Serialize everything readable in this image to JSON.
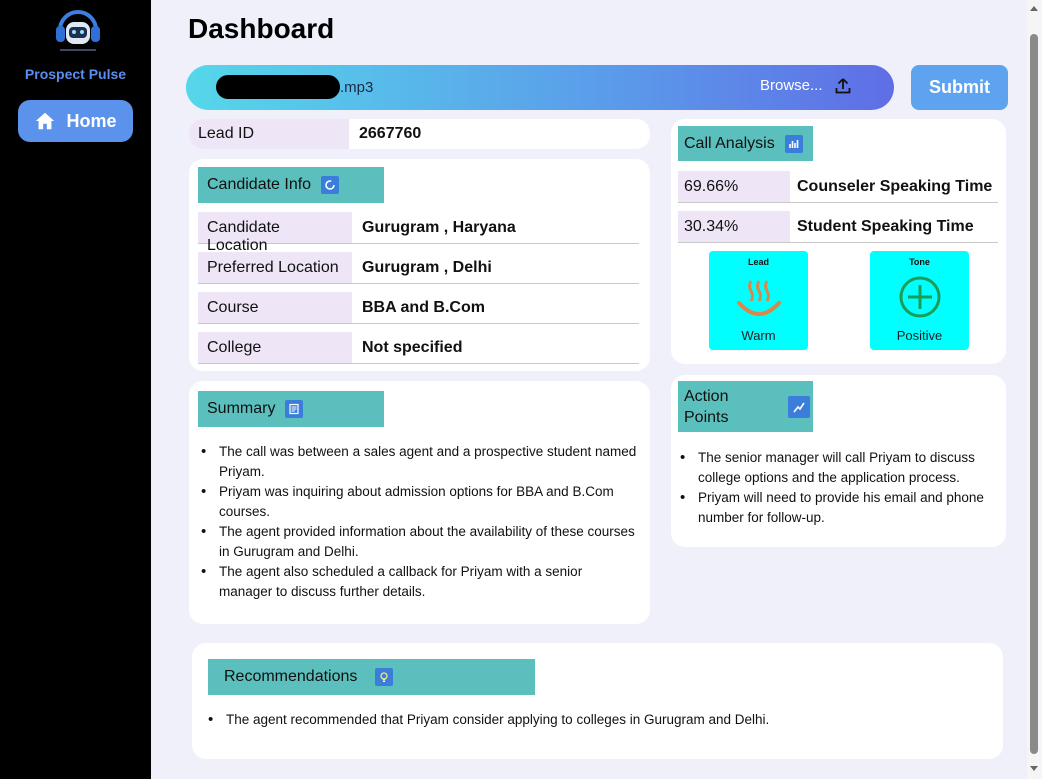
{
  "sidebar": {
    "brand": "Prospect Pulse",
    "home_label": "Home"
  },
  "page": {
    "title": "Dashboard"
  },
  "upload": {
    "file_ext": ".mp3",
    "browse_label": "Browse...",
    "submit_label": "Submit"
  },
  "lead": {
    "label": "Lead ID",
    "value": "2667760"
  },
  "candidate": {
    "header": "Candidate Info",
    "rows": [
      {
        "label": "Candidate Location",
        "value": "Gurugram , Haryana"
      },
      {
        "label": "Preferred Location",
        "value": "Gurugram , Delhi"
      },
      {
        "label": "Course",
        "value": "BBA and B.Com"
      },
      {
        "label": "College",
        "value": "Not specified"
      }
    ]
  },
  "summary": {
    "header": "Summary",
    "items": [
      "The call was between a sales agent and a prospective student named Priyam.",
      "Priyam was inquiring about admission options for BBA and B.Com courses.",
      "The agent provided information about the availability of these courses in Gurugram and Delhi.",
      "The agent also scheduled a callback for Priyam with a senior manager to discuss further details."
    ]
  },
  "call_analysis": {
    "header": "Call Analysis",
    "rows": [
      {
        "pct": "69.66%",
        "label": "Counseler Speaking Time"
      },
      {
        "pct": "30.34%",
        "label": "Student Speaking Time"
      }
    ],
    "lead_tile": {
      "title": "Lead",
      "value": "Warm"
    },
    "tone_tile": {
      "title": "Tone",
      "value": "Positive"
    }
  },
  "action_points": {
    "header_line1": "Action",
    "header_line2": "Points",
    "items": [
      "The senior manager will call Priyam to discuss college options and the application process.",
      "Priyam will need to provide his email and phone number for follow-up."
    ]
  },
  "recommendations": {
    "header": "Recommendations",
    "items": [
      "The agent recommended that Priyam consider applying to colleges in Gurugram and Delhi."
    ]
  },
  "colors": {
    "sidebar_bg": "#000000",
    "brand": "#5b8def",
    "accent_teal": "#5bbfbd",
    "tile": "#00ffff",
    "label_bg": "#eee5f7",
    "submit": "#5ea3f0"
  }
}
